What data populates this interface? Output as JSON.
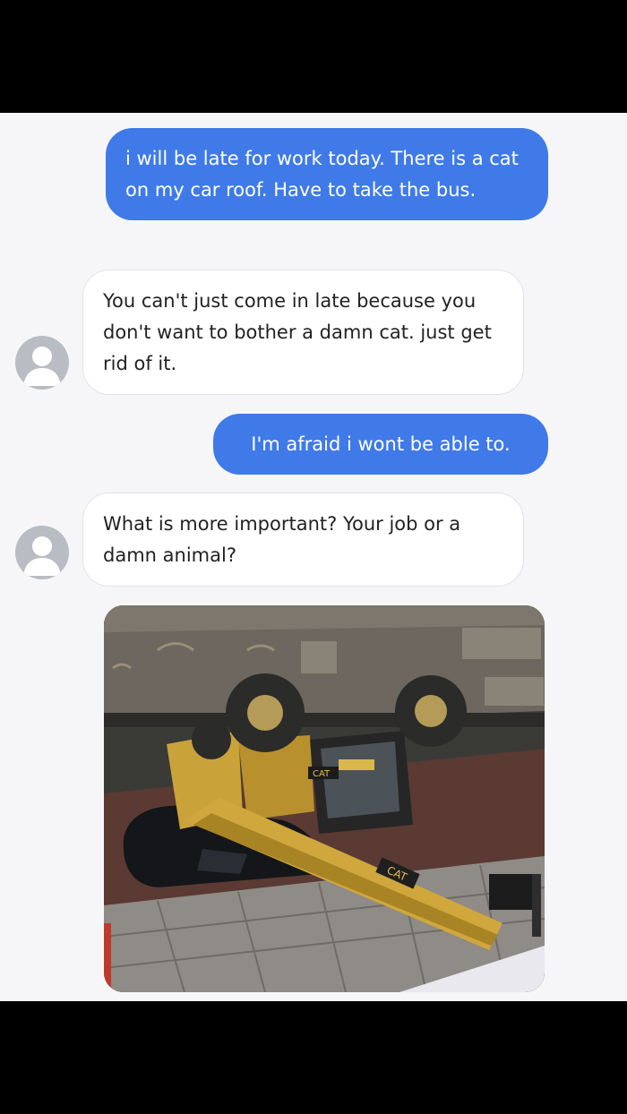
{
  "messages": [
    {
      "from": "me",
      "text": "i will be late for work today. There is a cat on my car roof. Have to take the bus."
    },
    {
      "from": "them",
      "text": "You can't just come in late because you don't want to bother a damn cat. just get rid of it."
    },
    {
      "from": "me",
      "text": "I'm afraid i wont be able to."
    },
    {
      "from": "them",
      "text": "What is more important? Your job or a damn animal?"
    },
    {
      "from": "them",
      "type": "image",
      "image_logos": [
        "CAT",
        "CAT"
      ]
    }
  ],
  "colors": {
    "outgoing_bubble": "#3f7ae8",
    "incoming_bubble": "#ffffff",
    "chat_background": "#f6f6f8",
    "avatar": "#b9bcc3"
  },
  "icons": [
    "default-user-avatar-icon"
  ]
}
